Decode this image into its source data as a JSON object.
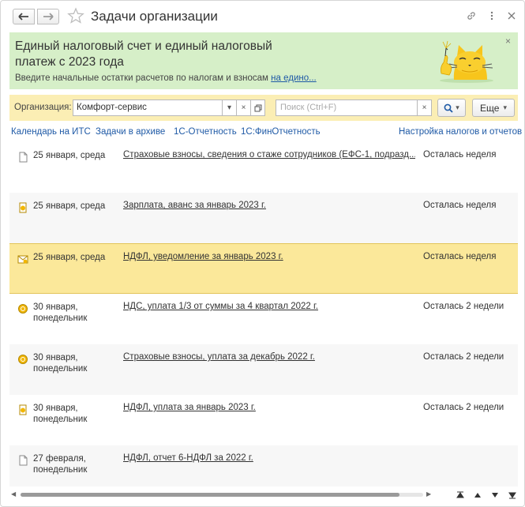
{
  "window": {
    "title": "Задачи организации"
  },
  "banner": {
    "title": "Единый налоговый счет и единый налоговый платеж с 2023 года",
    "text": "Введите начальные остатки расчетов по налогам и взносам ",
    "link": "на едино...",
    "close": "×"
  },
  "filters": {
    "org_label": "Организация:",
    "org_value": "Комфорт-сервис",
    "search_placeholder": "Поиск (Ctrl+F)",
    "more_label": "Еще"
  },
  "links": {
    "calendar": "Календарь на ИТС",
    "archive": "Задачи в архиве",
    "reporting": "1С-Отчетность",
    "finreporting": "1С:ФинОтчетность",
    "settings": "Настройка налогов и отчетов"
  },
  "tasks": [
    {
      "date": "25 января, среда",
      "task": "Страховые взносы, сведения о стаже сотрудников (ЕФС-1, подразд...",
      "due": "Осталась неделя",
      "icon": "document-icon"
    },
    {
      "date": "25 января, среда",
      "task": "Зарплата, аванс за январь 2023 г.",
      "due": "Осталась неделя",
      "icon": "payment-icon"
    },
    {
      "date": "25 января, среда",
      "task": "НДФЛ, уведомление за январь 2023 г.",
      "due": "Осталась неделя",
      "icon": "notice-icon"
    },
    {
      "date": "30 января, понедельник",
      "task": "НДС, уплата 1/3 от суммы за 4 квартал 2022 г.",
      "due": "Осталась 2 недели",
      "icon": "coin-icon"
    },
    {
      "date": "30 января, понедельник",
      "task": "Страховые взносы, уплата за декабрь 2022 г.",
      "due": "Осталась 2 недели",
      "icon": "coin-icon"
    },
    {
      "date": "30 января, понедельник",
      "task": "НДФЛ, уплата за январь 2023 г.",
      "due": "Осталась 2 недели",
      "icon": "payment-icon"
    },
    {
      "date": "27 февраля, понедельник",
      "task": "НДФЛ, отчет 6-НДФЛ за 2022 г.",
      "due": "",
      "icon": "document-icon"
    }
  ],
  "colors": {
    "banner_bg": "#d6efc8",
    "filter_bg": "#fbeeb4",
    "selected_row": "#fbe89a",
    "link": "#1f5aa6"
  }
}
